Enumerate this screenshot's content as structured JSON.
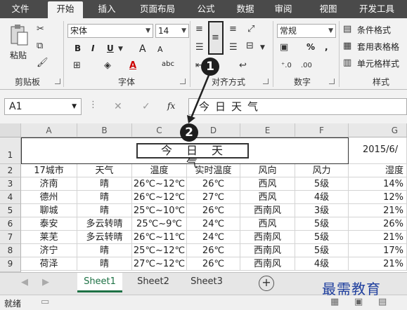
{
  "ribbon_tabs": [
    "文件",
    "开始",
    "插入",
    "页面布局",
    "公式",
    "数据",
    "审阅",
    "视图",
    "开发工具"
  ],
  "active_tab": "开始",
  "clipboard": {
    "paste_label": "粘贴",
    "group_label": "剪贴板"
  },
  "font": {
    "name": "宋体",
    "size": "14",
    "bold": "B",
    "italic": "I",
    "underline": "U",
    "grow": "A",
    "shrink": "A",
    "phonetic": "abc",
    "group_label": "字体"
  },
  "alignment": {
    "group_label": "对齐方式"
  },
  "number": {
    "format": "常规",
    "percent": "%",
    "comma": ",",
    "group_label": "数字"
  },
  "styles": {
    "conditional": "条件格式",
    "table_format": "套用表格格",
    "cell_style": "单元格样式",
    "group_label": "样式"
  },
  "callouts": [
    "1",
    "2"
  ],
  "formula_bar": {
    "name_box": "A1",
    "cancel": "✕",
    "confirm": "✓",
    "fx": "fx",
    "content": "今日天气"
  },
  "columns": [
    "A",
    "B",
    "C",
    "D",
    "E",
    "F",
    "G"
  ],
  "rows": [
    "1",
    "2",
    "3",
    "4",
    "5",
    "6",
    "7",
    "8",
    "9"
  ],
  "title_cell": "今日天气",
  "date_cell": "2015/6/",
  "headers": [
    "17城市",
    "天气",
    "温度",
    "实时温度",
    "风向",
    "风力",
    "湿度"
  ],
  "data_rows": [
    [
      "济南",
      "晴",
      "26℃~12℃",
      "26℃",
      "西风",
      "5级",
      "14%"
    ],
    [
      "德州",
      "晴",
      "26℃~12℃",
      "27℃",
      "西风",
      "4级",
      "12%"
    ],
    [
      "聊城",
      "晴",
      "25℃~10℃",
      "26℃",
      "西南风",
      "3级",
      "21%"
    ],
    [
      "泰安",
      "多云转晴",
      "25℃~9℃",
      "24℃",
      "西风",
      "5级",
      "26%"
    ],
    [
      "莱芜",
      "多云转晴",
      "26℃~11℃",
      "24℃",
      "西南风",
      "5级",
      "21%"
    ],
    [
      "济宁",
      "晴",
      "25℃~12℃",
      "26℃",
      "西南风",
      "5级",
      "17%"
    ],
    [
      "荷泽",
      "晴",
      "27℃~12℃",
      "26℃",
      "西南风",
      "4级",
      "21%"
    ]
  ],
  "sheets": [
    "Sheet1",
    "Sheet2",
    "Sheet3"
  ],
  "active_sheet": "Sheet1",
  "status": {
    "ready": "就绪"
  },
  "watermark": "最需教育"
}
